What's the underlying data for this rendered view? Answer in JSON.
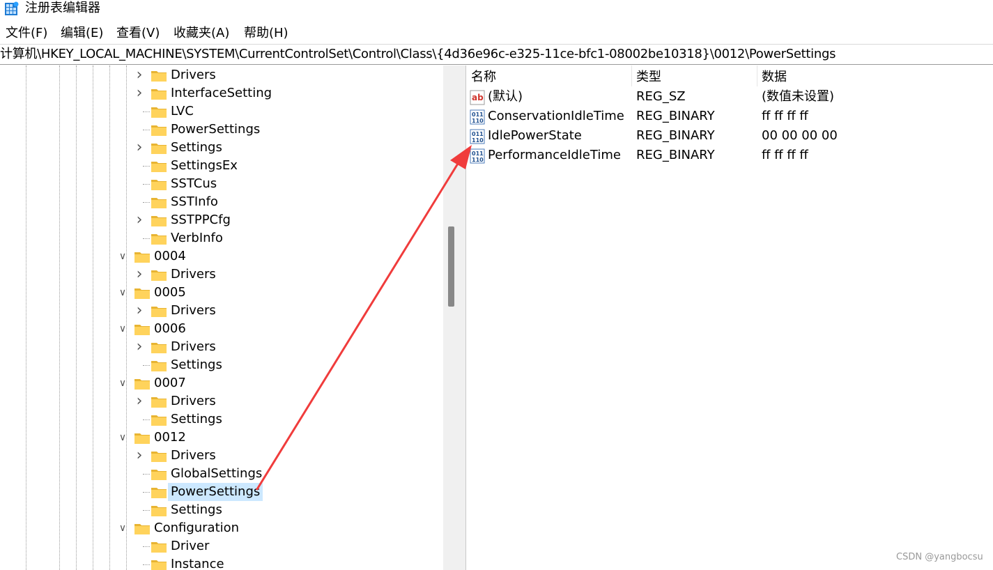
{
  "window": {
    "title": "注册表编辑器"
  },
  "menu": [
    "文件(F)",
    "编辑(E)",
    "查看(V)",
    "收藏夹(A)",
    "帮助(H)"
  ],
  "address": "计算机\\HKEY_LOCAL_MACHINE\\SYSTEM\\CurrentControlSet\\Control\\Class\\{4d36e96c-e325-11ce-bfc1-08002be10318}\\0012\\PowerSettings",
  "tree": [
    {
      "label": "Drivers",
      "level": 2,
      "expander": "collapsed"
    },
    {
      "label": "InterfaceSetting",
      "level": 2,
      "expander": "collapsed"
    },
    {
      "label": "LVC",
      "level": 2,
      "expander": "none"
    },
    {
      "label": "PowerSettings",
      "level": 2,
      "expander": "none"
    },
    {
      "label": "Settings",
      "level": 2,
      "expander": "collapsed"
    },
    {
      "label": "SettingsEx",
      "level": 2,
      "expander": "none"
    },
    {
      "label": "SSTCus",
      "level": 2,
      "expander": "none"
    },
    {
      "label": "SSTInfo",
      "level": 2,
      "expander": "none"
    },
    {
      "label": "SSTPPCfg",
      "level": 2,
      "expander": "collapsed"
    },
    {
      "label": "VerbInfo",
      "level": 2,
      "expander": "none"
    },
    {
      "label": "0004",
      "level": 1,
      "expander": "expanded"
    },
    {
      "label": "Drivers",
      "level": 2,
      "expander": "collapsed"
    },
    {
      "label": "0005",
      "level": 1,
      "expander": "expanded"
    },
    {
      "label": "Drivers",
      "level": 2,
      "expander": "collapsed"
    },
    {
      "label": "0006",
      "level": 1,
      "expander": "expanded"
    },
    {
      "label": "Drivers",
      "level": 2,
      "expander": "collapsed"
    },
    {
      "label": "Settings",
      "level": 2,
      "expander": "none"
    },
    {
      "label": "0007",
      "level": 1,
      "expander": "expanded"
    },
    {
      "label": "Drivers",
      "level": 2,
      "expander": "collapsed"
    },
    {
      "label": "Settings",
      "level": 2,
      "expander": "none"
    },
    {
      "label": "0012",
      "level": 1,
      "expander": "expanded"
    },
    {
      "label": "Drivers",
      "level": 2,
      "expander": "collapsed"
    },
    {
      "label": "GlobalSettings",
      "level": 2,
      "expander": "none"
    },
    {
      "label": "PowerSettings",
      "level": 2,
      "expander": "none",
      "selected": true
    },
    {
      "label": "Settings",
      "level": 2,
      "expander": "none"
    },
    {
      "label": "Configuration",
      "level": 1,
      "expander": "expanded"
    },
    {
      "label": "Driver",
      "level": 2,
      "expander": "none"
    },
    {
      "label": "Instance",
      "level": 2,
      "expander": "none"
    }
  ],
  "columns": {
    "name": "名称",
    "type": "类型",
    "data": "数据"
  },
  "values": [
    {
      "icon": "string-value-icon",
      "name": "(默认)",
      "type": "REG_SZ",
      "data": "(数值未设置)"
    },
    {
      "icon": "binary-value-icon",
      "name": "ConservationIdleTime",
      "type": "REG_BINARY",
      "data": "ff ff ff ff"
    },
    {
      "icon": "binary-value-icon",
      "name": "IdlePowerState",
      "type": "REG_BINARY",
      "data": "00 00 00 00"
    },
    {
      "icon": "binary-value-icon",
      "name": "PerformanceIdleTime",
      "type": "REG_BINARY",
      "data": "ff ff ff ff"
    }
  ],
  "colors": {
    "selection": "#cce8ff",
    "folder": "#ffd35c",
    "annotation_arrow": "#f03c3c"
  },
  "watermark": "CSDN @yangbocsu"
}
